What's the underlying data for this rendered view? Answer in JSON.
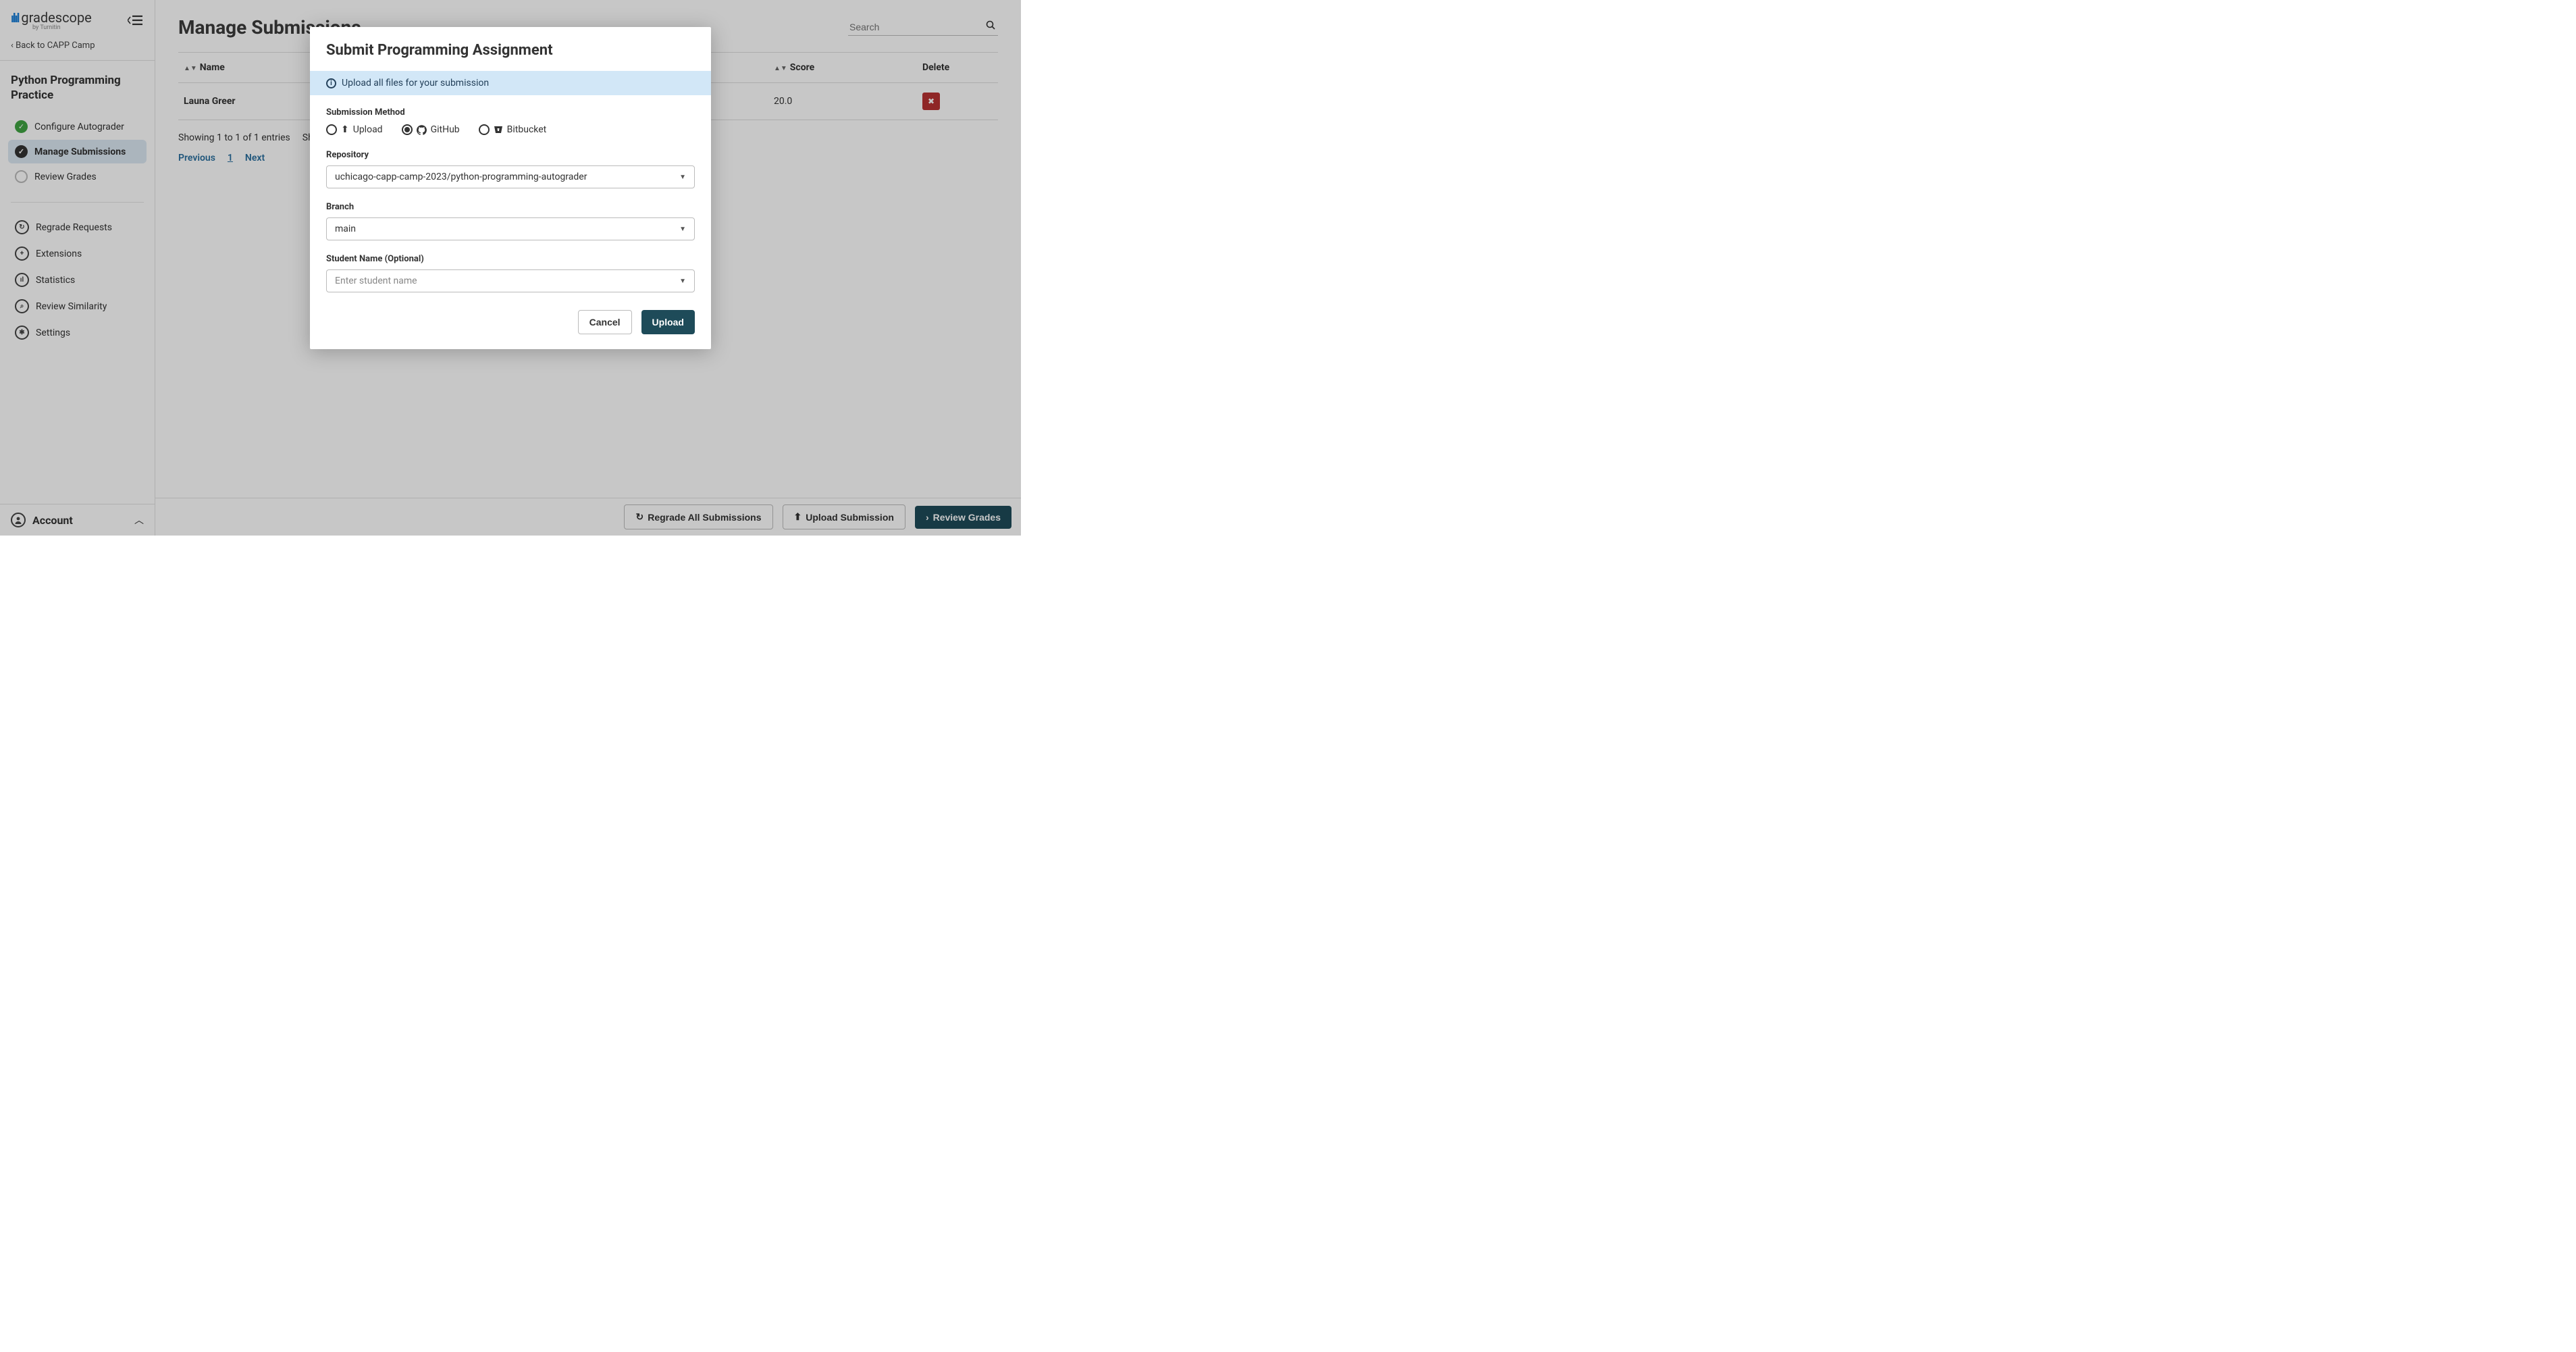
{
  "logo": {
    "brand": "gradescope",
    "byline": "by Turnitin"
  },
  "back_link": "Back to CAPP Camp",
  "course_title": "Python Programming Practice",
  "sidebar_primary": [
    {
      "label": "Configure Autograder",
      "status": "green"
    },
    {
      "label": "Manage Submissions",
      "status": "dark",
      "active": true
    },
    {
      "label": "Review Grades",
      "status": "empty"
    }
  ],
  "sidebar_secondary": [
    {
      "label": "Regrade Requests",
      "glyph": "↻"
    },
    {
      "label": "Extensions",
      "glyph": "+"
    },
    {
      "label": "Statistics",
      "glyph": "ıl"
    },
    {
      "label": "Review Similarity",
      "glyph": "⌕"
    },
    {
      "label": "Settings",
      "glyph": "✱"
    }
  ],
  "account_label": "Account",
  "page_title": "Manage Submissions",
  "search_placeholder": "Search",
  "table": {
    "cols": {
      "name": "Name",
      "score": "Score",
      "delete": "Delete"
    },
    "rows": [
      {
        "name": "Launa Greer",
        "score": "20.0"
      }
    ]
  },
  "entry_text": "Showing 1 to 1 of 1 entries",
  "show_text": "Sho",
  "pager": {
    "prev": "Previous",
    "cur": "1",
    "next": "Next"
  },
  "footer_buttons": {
    "regrade": "Regrade All Submissions",
    "upload": "Upload Submission",
    "review": "Review Grades"
  },
  "modal": {
    "title": "Submit Programming Assignment",
    "info": "Upload all files for your submission",
    "method_label": "Submission Method",
    "methods": {
      "upload": "Upload",
      "github": "GitHub",
      "bitbucket": "Bitbucket"
    },
    "selected_method": "github",
    "repo_label": "Repository",
    "repo_value": "uchicago-capp-camp-2023/python-programming-autograder",
    "branch_label": "Branch",
    "branch_value": "main",
    "student_label": "Student Name (Optional)",
    "student_placeholder": "Enter student name",
    "cancel_label": "Cancel",
    "upload_label": "Upload"
  }
}
